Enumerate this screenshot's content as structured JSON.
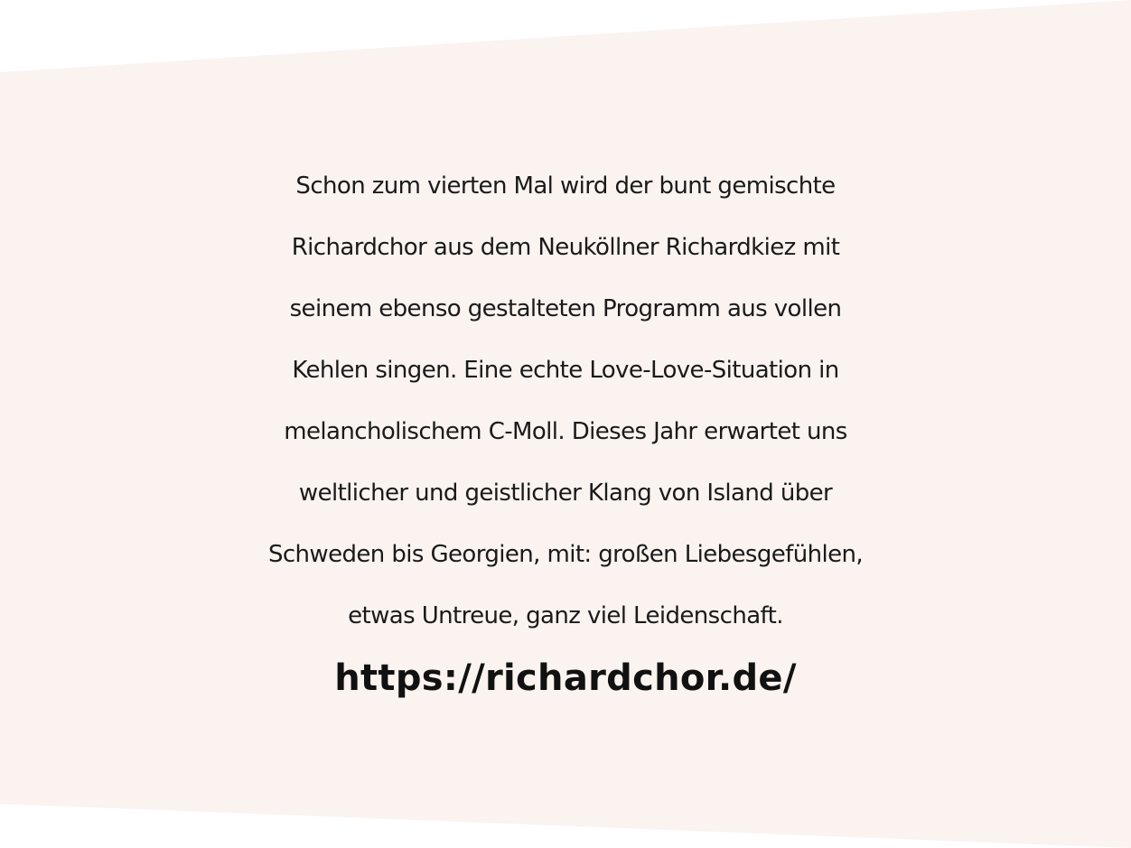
{
  "panel": {
    "background_color": "#faf3f0",
    "text_color": "#1a1a1a"
  },
  "body": {
    "lines": [
      "Schon zum vierten Mal wird der bunt gemischte",
      "Richardchor aus dem Neuköllner Richardkiez mit",
      "seinem ebenso gestalteten Programm aus vollen",
      "Kehlen singen. Eine echte Love-Love-Situation in",
      "melancholischem C-Moll. Dieses Jahr erwartet uns",
      "weltlicher und geistlicher Klang von Island über",
      "Schweden bis Georgien, mit: großen Liebesgefühlen,",
      "etwas Untreue, ganz viel Leidenschaft."
    ]
  },
  "link": {
    "text": "https://richardchor.de/",
    "href": "https://richardchor.de/"
  }
}
